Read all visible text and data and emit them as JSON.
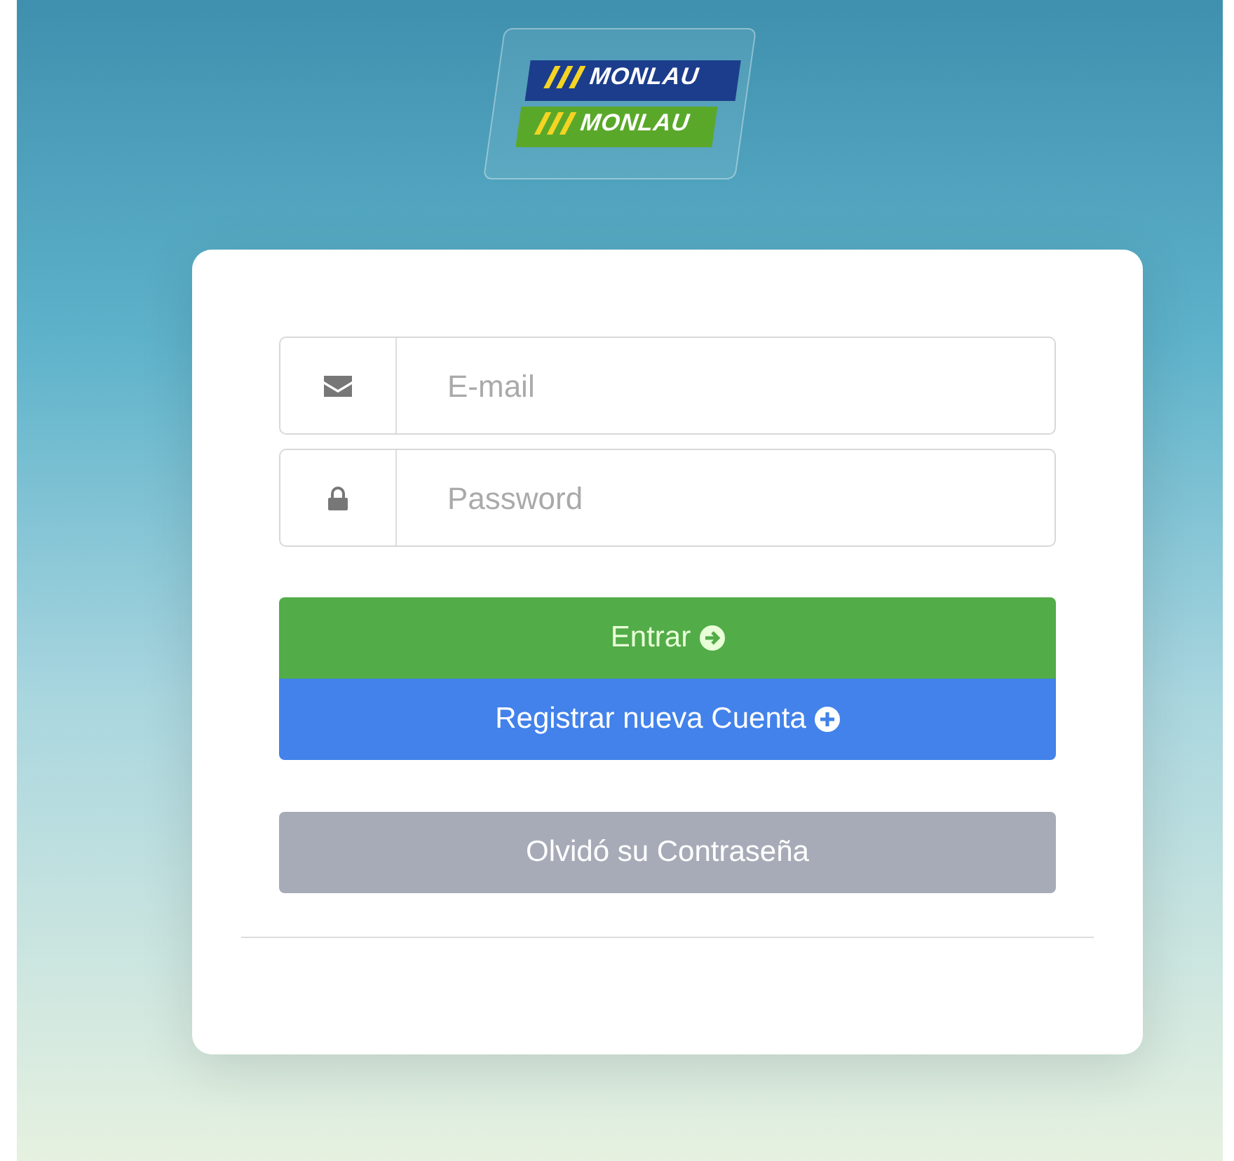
{
  "logo": {
    "badges": [
      {
        "text": "MONLAU",
        "kind": "blue"
      },
      {
        "text": "MONLAU",
        "kind": "green"
      }
    ]
  },
  "fields": [
    {
      "kind": "email",
      "placeholder": "E-mail"
    },
    {
      "kind": "password",
      "placeholder": "Password"
    }
  ],
  "buttons": [
    {
      "kind": "login",
      "label": "Entrar"
    },
    {
      "kind": "register",
      "label": "Registrar nueva Cuenta"
    },
    {
      "kind": "forgot",
      "label": "Olvidó su Contraseña"
    }
  ]
}
